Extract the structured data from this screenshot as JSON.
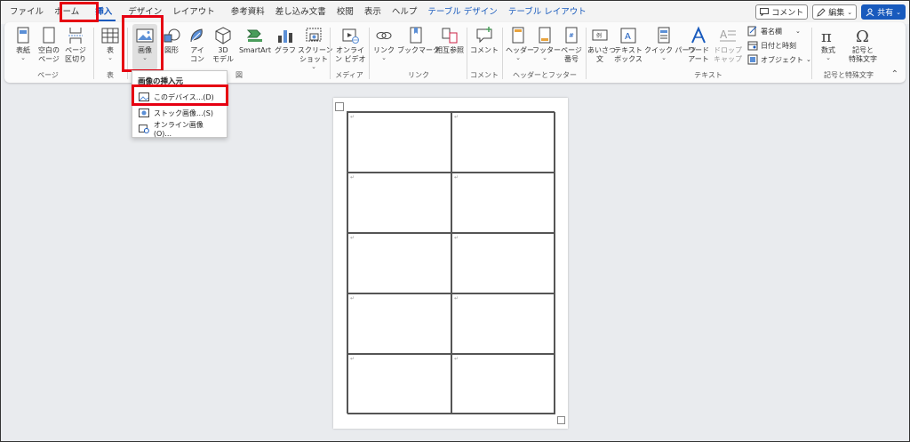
{
  "tabs": [
    {
      "label": "ファイル"
    },
    {
      "label": "ホーム"
    },
    {
      "label": "挿入",
      "active": true
    },
    {
      "label": "デザイン"
    },
    {
      "label": "レイアウト"
    },
    {
      "label": "参考資料"
    },
    {
      "label": "差し込み文書"
    },
    {
      "label": "校閲"
    },
    {
      "label": "表示"
    },
    {
      "label": "ヘルプ"
    },
    {
      "label": "テーブル デザイン",
      "context": true
    },
    {
      "label": "テーブル レイアウト",
      "context": true
    }
  ],
  "topright": {
    "comment": "コメント",
    "edit": "編集",
    "share": "共有"
  },
  "ribbon": {
    "pages": {
      "label": "ページ",
      "cover": "表紙",
      "blank": "空白の\nページ",
      "break": "ページ\n区切り"
    },
    "table": {
      "label": "表",
      "table": "表"
    },
    "illust": {
      "label": "図",
      "image": "画像",
      "shapes": "図形",
      "icons": "アイ\nコン",
      "3d": "3D\nモデル",
      "smartart": "SmartArt",
      "chart": "グラフ",
      "screenshot": "スクリーン\nショット"
    },
    "media": {
      "label": "メディア",
      "online_video": "オンライ\nン ビデオ"
    },
    "links": {
      "label": "リンク",
      "link": "リンク",
      "bookmark": "ブックマーク",
      "cross_ref": "相互参照"
    },
    "comments": {
      "label": "コメント",
      "comment": "コメント"
    },
    "header_footer": {
      "label": "ヘッダーとフッター",
      "header": "ヘッダー",
      "footer": "フッター",
      "page_num": "ページ\n番号"
    },
    "text": {
      "label": "テキスト",
      "greeting": "あいさつ\n文",
      "textbox": "テキスト\nボックス",
      "quick_parts": "クイック パーツ",
      "wordart": "ワード\nアート",
      "dropcap": "ドロップ\nキャップ",
      "signature": "署名欄",
      "datetime": "日付と時刻",
      "object": "オブジェクト"
    },
    "symbols": {
      "label": "記号と特殊文字",
      "equation": "数式",
      "symbol": "記号と\n特殊文字"
    }
  },
  "dropdown": {
    "title": "画像の挿入元",
    "items": [
      {
        "label": "このデバイス...(D)"
      },
      {
        "label": "ストック画像...(S)"
      },
      {
        "label": "オンライン画像(O)..."
      }
    ]
  },
  "colors": {
    "accent": "#185abd",
    "highlight": "#e60012"
  }
}
